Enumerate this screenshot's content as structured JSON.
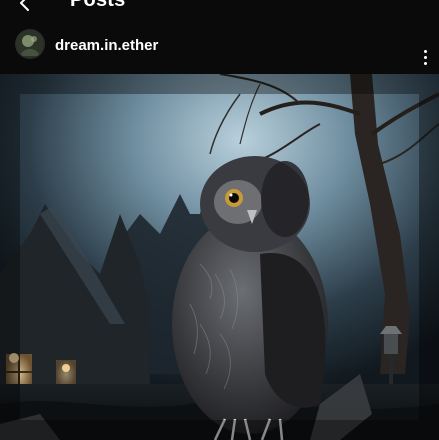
{
  "nav": {
    "title": "Posts",
    "back_icon": "back-arrow-icon"
  },
  "post": {
    "username": "dream.in.ether",
    "more_icon": "more-vertical-icon",
    "image_description_icon": "photo"
  },
  "colors": {
    "background": "#000000",
    "text": "#ffffff"
  }
}
